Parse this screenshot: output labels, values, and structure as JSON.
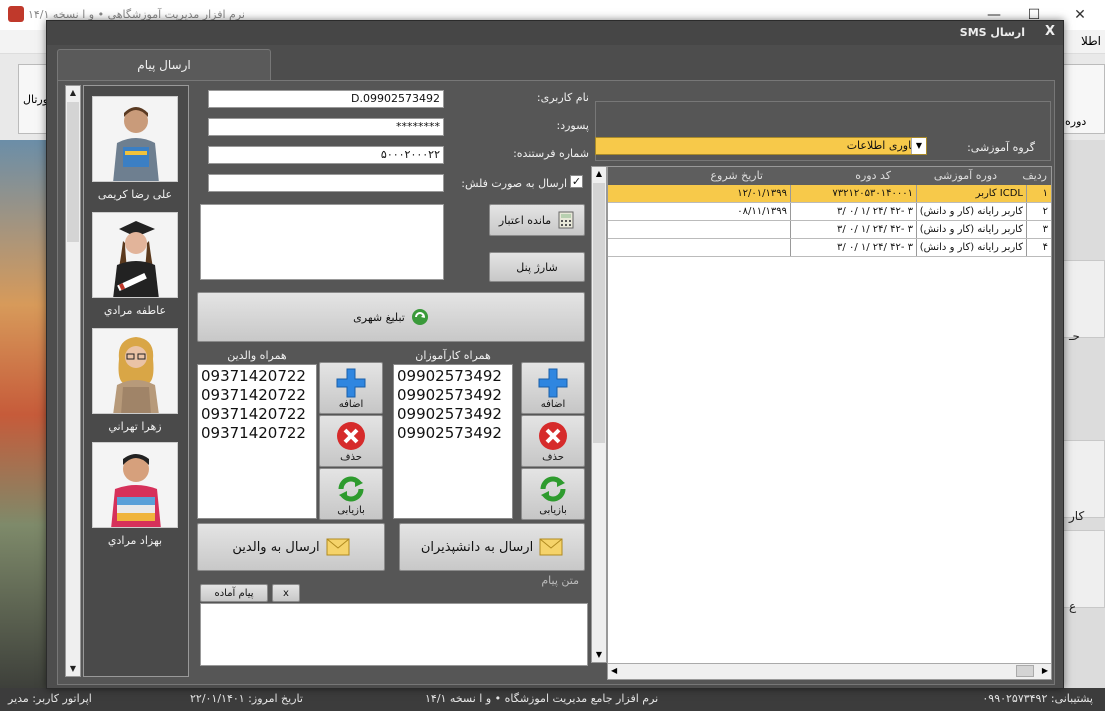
{
  "app": {
    "title": "نرم افزار مدیریت آموزشگاهی • و ا نسخه ۱۴/۱",
    "portal_btn": "پورتال",
    "menu_right": "اطلا",
    "side_btn_1": "دوره",
    "side_btn_2": "حـ",
    "side_btn_3": "کار",
    "side_btn_4": "ع"
  },
  "status": {
    "support": "پشتیبانی: ۰۹۹۰۲۵۷۳۴۹۲",
    "software": "نرم افزار جامع مدیریت اموزشگاه • و ا نسخه ۱۴/۱",
    "today": "تاریخ امروز: ۲۲/۰۱/۱۴۰۱",
    "operator": "اپراتور کاربر: مدیر"
  },
  "dialog": {
    "title": "ارسال SMS",
    "close": "X",
    "tab": "ارسال پیام"
  },
  "students": [
    {
      "name": "علی رضا کریمی"
    },
    {
      "name": "عاطفه مرادي"
    },
    {
      "name": "زهرا تهراني"
    },
    {
      "name": "بهزاد مرادي"
    }
  ],
  "form": {
    "username_label": "نام کاربری:",
    "username_value": "D.09902573492",
    "password_label": "پسورد:",
    "password_value": "********",
    "sender_label": "شماره فرستنده:",
    "sender_value": "۵۰۰۰۲۰۰۰۲۲",
    "flash_label": "ارسال به صورت فلش:",
    "balance_btn": "مانده اعتبار",
    "charge_btn": "شارژ پنل",
    "ad_btn": "تبلیغ شهری"
  },
  "lists": {
    "parents_title": "همراه والدین",
    "students_title": "همراه کارآموزان",
    "parents_numbers": [
      "09371420722",
      "09371420722",
      "09371420722",
      "09371420722"
    ],
    "students_numbers": [
      "09902573492",
      "09902573492",
      "09902573492",
      "09902573492"
    ],
    "add_label": "اضافه",
    "delete_label": "حذف",
    "refresh_label": "بازیابی",
    "send_parents": "ارسال به والدین",
    "send_students": "ارسال به دانشپذیران"
  },
  "message": {
    "label": "متن پیام",
    "ready_msg_btn": "پیام آماده",
    "clear_btn": "x"
  },
  "group": {
    "label": "گروه آموزشی:",
    "value": "فناوری اطلاعات"
  },
  "grid": {
    "headers": [
      "ردیف",
      "دوره آموزشی",
      "کد دوره",
      "تاریخ شروع"
    ],
    "rows": [
      {
        "row": "۱",
        "course": "کاربر ICDL",
        "code": "۷۳۲۱۲۰۵۳۰۱۴۰۰۰۱",
        "start": "۱۲/۰۱/۱۳۹۹"
      },
      {
        "row": "۲",
        "course": "کاربر رایانه (کار و دانش)",
        "code": "۳/ ۰/ ۱/ ۲۴/ ۴۲- ۳",
        "start": "۰۸/۱۱/۱۳۹۹"
      },
      {
        "row": "۳",
        "course": "کاربر رایانه (کار و دانش)",
        "code": "۳/ ۰/ ۱/ ۲۴/ ۴۲- ۳",
        "start": ""
      },
      {
        "row": "۴",
        "course": "کاربر رایانه (کار و دانش)",
        "code": "۳/ ۰/ ۱/ ۲۴/ ۴۲- ۳",
        "start": ""
      }
    ]
  },
  "colors": {
    "selected_row": "#f7c94a",
    "dialog_bg": "#4d4d4d"
  }
}
